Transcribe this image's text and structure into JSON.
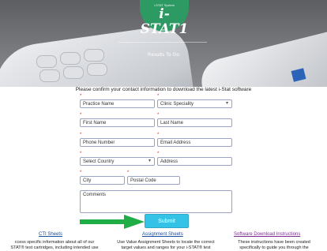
{
  "hero": {
    "badge_subtitle": "i-STAT System",
    "badge_logo": "i-STAT1",
    "tagline": "Results To Go"
  },
  "intro": "Please confirm your contact information to download the latest i-Stat software",
  "form": {
    "required_mark": "*",
    "practice_name": "Practice Name",
    "clinic_specialty": "Clinic Speciality",
    "first_name": "First Name",
    "last_name": "Last Name",
    "phone": "Phone Number",
    "email": "Email Address",
    "country": "Select Country",
    "address": "Address",
    "city": "City",
    "postal": "Postal Code",
    "comments": "Comments",
    "submit_label": "Submit"
  },
  "footer": {
    "cti": {
      "label": "CTI Sheets",
      "desc1": "ccess specific information about all of our",
      "desc2": "STAT® test cartridges, including intended use"
    },
    "assignment": {
      "label": "Assignment Sheets",
      "desc1": "Use Value Assignment Sheets to locate the correct",
      "desc2": "target values and ranges for your i-STAT® test"
    },
    "software": {
      "label": "Software Download Instructions",
      "desc1": "These instructions have been created",
      "desc2": "specifically to guide you through the"
    }
  },
  "colors": {
    "accent_green": "#2e9a63",
    "submit_blue": "#35c2e7",
    "arrow_green": "#1fae45",
    "link_blue": "#1a4fa0",
    "link_purple": "#7b2d8e",
    "required_red": "#d12b2b"
  }
}
